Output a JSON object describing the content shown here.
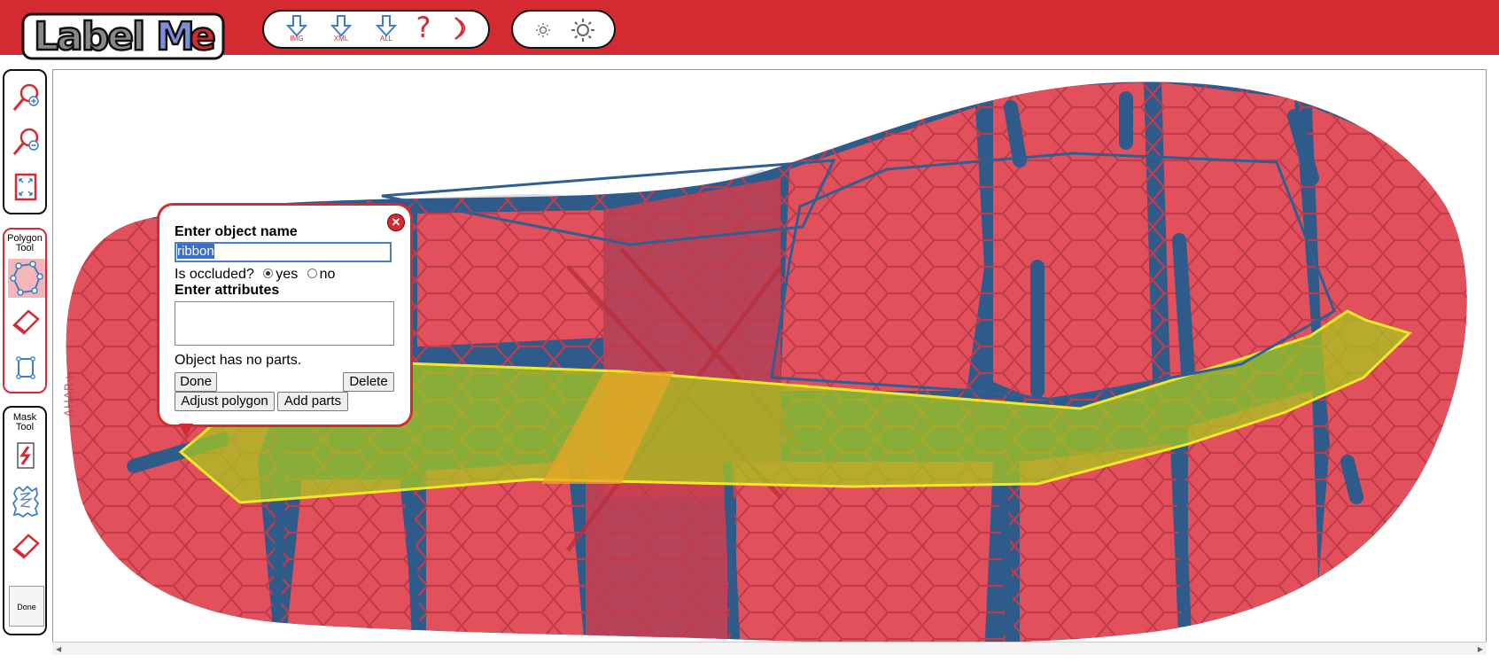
{
  "app": {
    "logo_text": "LabelMe",
    "brand_color": "#d42a31"
  },
  "toolbar": {
    "download_image_label": "IMG",
    "download_xml_label": "XML",
    "download_all_label": "ALL",
    "help_icon": "question-mark-icon",
    "signout_icon": "moon-icon",
    "brightness_down_icon": "sun-small-icon",
    "brightness_up_icon": "sun-large-icon"
  },
  "sidebar": {
    "view_tools": [
      "zoom-in-icon",
      "zoom-out-icon",
      "fit-image-icon"
    ],
    "polygon_tool": {
      "title": "Polygon Tool",
      "tools": [
        "polygon-icon",
        "eraser-icon",
        "bounding-box-icon"
      ],
      "active": "polygon-icon"
    },
    "mask_tool": {
      "title": "Mask Tool",
      "tools": [
        "brush-icon",
        "scribble-region-icon",
        "eraser-icon"
      ],
      "done_label": "Done"
    }
  },
  "annotation_popup": {
    "title": "Enter object name",
    "object_name": "ribbon",
    "occluded_label": "Is occluded?",
    "occluded_yes": "yes",
    "occluded_no": "no",
    "occluded_value": "yes",
    "attributes_label": "Enter attributes",
    "attributes_value": "",
    "parts_text": "Object has no parts.",
    "done_button": "Done",
    "delete_button": "Delete",
    "adjust_button": "Adjust polygon",
    "add_parts_button": "Add parts"
  },
  "image": {
    "subject": "running shoe outsole",
    "polygon_colors": {
      "selected_outline": "#f2e82a",
      "selected_fill": "#a8c81e",
      "other_outline": "#2f5f92"
    }
  }
}
